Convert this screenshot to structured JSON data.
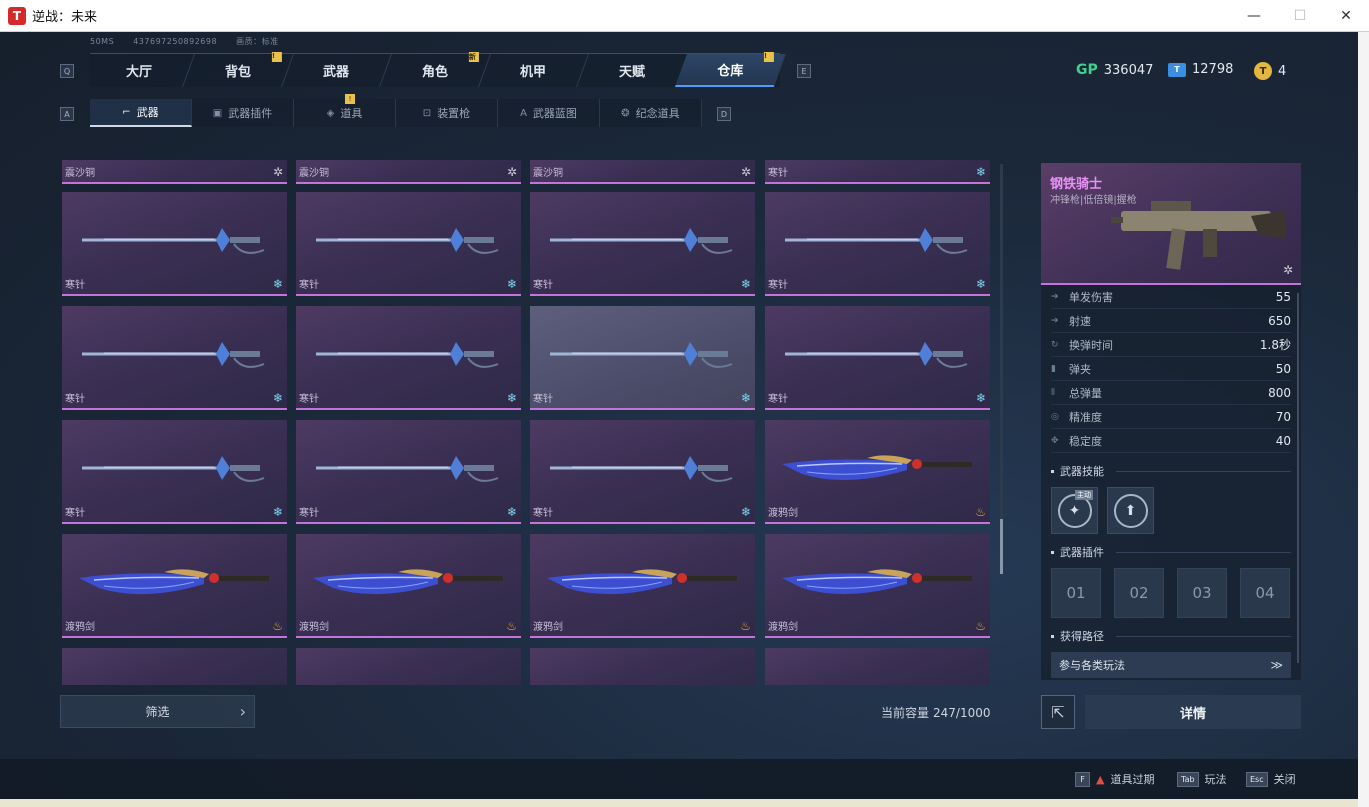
{
  "window": {
    "title": "逆战：未来",
    "logo": "T",
    "minimize": "—",
    "maximize": "☐",
    "close": "✕"
  },
  "meta": {
    "ping": "50MS",
    "id": "437697250892698",
    "quality": "画质：标准"
  },
  "keys": {
    "prev_main": "Q",
    "next_main": "E",
    "prev_sub": "A",
    "next_sub": "D"
  },
  "main_tabs": [
    {
      "label": "大厅"
    },
    {
      "label": "背包",
      "badge": "!"
    },
    {
      "label": "武器"
    },
    {
      "label": "角色",
      "badge": "新"
    },
    {
      "label": "机甲"
    },
    {
      "label": "天赋"
    },
    {
      "label": "仓库",
      "badge": "!",
      "active": true
    }
  ],
  "sub_tabs": [
    {
      "label": "武器",
      "active": true
    },
    {
      "label": "武器插件"
    },
    {
      "label": "道具",
      "badge": "!"
    },
    {
      "label": "装置枪"
    },
    {
      "label": "武器蓝图"
    },
    {
      "label": "纪念道具"
    }
  ],
  "currency": {
    "gp_label": "GP",
    "gp": "336047",
    "ticket_label": "T",
    "ticket": "12798",
    "coin_label": "T",
    "coin": "4"
  },
  "items": [
    {
      "name": "震沙铜",
      "icon": "star",
      "partial": true
    },
    {
      "name": "震沙铜",
      "icon": "star",
      "partial": true
    },
    {
      "name": "震沙铜",
      "icon": "star",
      "partial": true
    },
    {
      "name": "寒针",
      "icon": "snow",
      "partial": true
    },
    {
      "name": "寒针",
      "icon": "snow",
      "weapon": "needle"
    },
    {
      "name": "寒针",
      "icon": "snow",
      "weapon": "needle"
    },
    {
      "name": "寒针",
      "icon": "snow",
      "weapon": "needle"
    },
    {
      "name": "寒针",
      "icon": "snow",
      "weapon": "needle"
    },
    {
      "name": "寒针",
      "icon": "snow",
      "weapon": "needle"
    },
    {
      "name": "寒针",
      "icon": "snow",
      "weapon": "needle"
    },
    {
      "name": "寒针",
      "icon": "snow",
      "weapon": "needle",
      "selected": true
    },
    {
      "name": "寒针",
      "icon": "snow",
      "weapon": "needle"
    },
    {
      "name": "寒针",
      "icon": "snow",
      "weapon": "needle"
    },
    {
      "name": "寒针",
      "icon": "snow",
      "weapon": "needle"
    },
    {
      "name": "寒针",
      "icon": "snow",
      "weapon": "needle"
    },
    {
      "name": "渡鸦剑",
      "icon": "fire",
      "weapon": "raven"
    },
    {
      "name": "渡鸦剑",
      "icon": "fire",
      "weapon": "raven"
    },
    {
      "name": "渡鸦剑",
      "icon": "fire",
      "weapon": "raven"
    },
    {
      "name": "渡鸦剑",
      "icon": "fire",
      "weapon": "raven"
    },
    {
      "name": "渡鸦剑",
      "icon": "fire",
      "weapon": "raven"
    }
  ],
  "filter": {
    "label": "筛选",
    "arrow": "›"
  },
  "capacity": {
    "label": "当前容量",
    "value": "247/1000"
  },
  "detail": {
    "name": "钢铁骑士",
    "subtitle": "冲锋枪|低倍镜|握枪",
    "stats": [
      {
        "name": "单发伤害",
        "value": "55",
        "icon": "arrow-icon"
      },
      {
        "name": "射速",
        "value": "650",
        "icon": "arrow-icon"
      },
      {
        "name": "换弹时间",
        "value": "1.8秒",
        "icon": "reload-icon"
      },
      {
        "name": "弹夹",
        "value": "50",
        "icon": "magazine-icon"
      },
      {
        "name": "总弹量",
        "value": "800",
        "icon": "ammo-icon"
      },
      {
        "name": "精准度",
        "value": "70",
        "icon": "target-icon"
      },
      {
        "name": "稳定度",
        "value": "40",
        "icon": "stability-icon"
      }
    ],
    "skills_title": "武器技能",
    "skill_tag": "主动",
    "plugins_title": "武器插件",
    "slots": [
      "01",
      "02",
      "03",
      "04"
    ],
    "source_title": "获得路径",
    "source": "参与各类玩法",
    "source_arrow": "≫"
  },
  "buttons": {
    "share": "⇱",
    "details": "详情"
  },
  "hotkeys": [
    {
      "key": "F",
      "label": "道具过期",
      "warn": true
    },
    {
      "key": "Tab",
      "label": "玩法"
    },
    {
      "key": "Esc",
      "label": "关闭"
    }
  ]
}
